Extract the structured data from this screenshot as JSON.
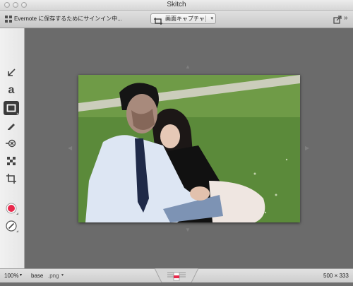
{
  "window": {
    "title": "Skitch"
  },
  "toolbar": {
    "signin_text": "Evernote に保存するためにサインイン中...",
    "capture_label": "画面キャプチャ",
    "capture_caret": "▾",
    "more_glyph": "»"
  },
  "tools": [
    {
      "name": "arrow-tool",
      "icon": "arrow-icon"
    },
    {
      "name": "text-tool",
      "icon": "text-a-icon",
      "glyph": "a"
    },
    {
      "name": "rectangle-tool",
      "icon": "rectangle-icon",
      "selected": true
    },
    {
      "name": "marker-tool",
      "icon": "pen-icon"
    },
    {
      "name": "stamp-tool",
      "icon": "stamp-icon"
    },
    {
      "name": "pixelate-tool",
      "icon": "pixelate-icon"
    },
    {
      "name": "crop-tool",
      "icon": "crop-icon"
    },
    {
      "name": "color-tool",
      "icon": "color-swatch-icon",
      "color": "#e8294c"
    },
    {
      "name": "stroke-tool",
      "icon": "stroke-size-icon"
    }
  ],
  "status": {
    "zoom": "100%",
    "zoom_caret": "▾",
    "filename": "base",
    "extension": ".png",
    "ext_caret": "▾",
    "dimensions": "500 × 333"
  },
  "colors": {
    "canvas": "#6b6b6b",
    "selected_tool": "#3b3b3b",
    "highlight": "#e8294c",
    "grass": "#5b8a3a"
  }
}
